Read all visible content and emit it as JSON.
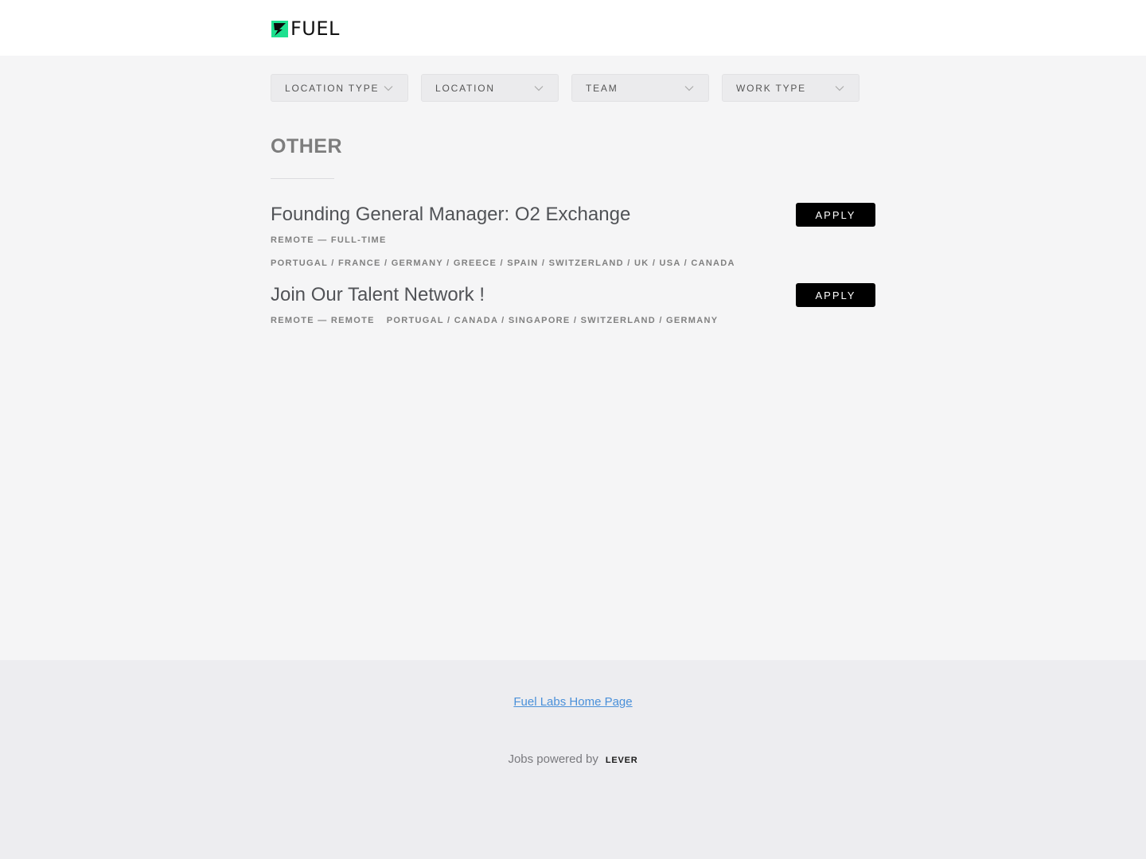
{
  "header": {
    "logo_text": "FUEL",
    "logo_accent": "#1ee08f"
  },
  "filters": [
    {
      "label": "LOCATION TYPE"
    },
    {
      "label": "LOCATION"
    },
    {
      "label": "TEAM"
    },
    {
      "label": "WORK TYPE"
    }
  ],
  "section": {
    "title": "OTHER"
  },
  "postings": [
    {
      "title": "Founding General Manager: O2 Exchange",
      "commitment": "REMOTE — FULL-TIME",
      "locations": "PORTUGAL / FRANCE / GERMANY / GREECE / SPAIN / SWITZERLAND / UK / USA / CANADA",
      "apply_label": "APPLY"
    },
    {
      "title": "Join Our Talent Network !",
      "commitment": "REMOTE — REMOTE",
      "locations": "PORTUGAL / CANADA / SINGAPORE / SWITZERLAND / GERMANY",
      "apply_label": "APPLY"
    }
  ],
  "footer": {
    "home_link": "Fuel Labs Home Page",
    "powered_by": "Jobs powered by",
    "powered_logo": "LEVER"
  }
}
